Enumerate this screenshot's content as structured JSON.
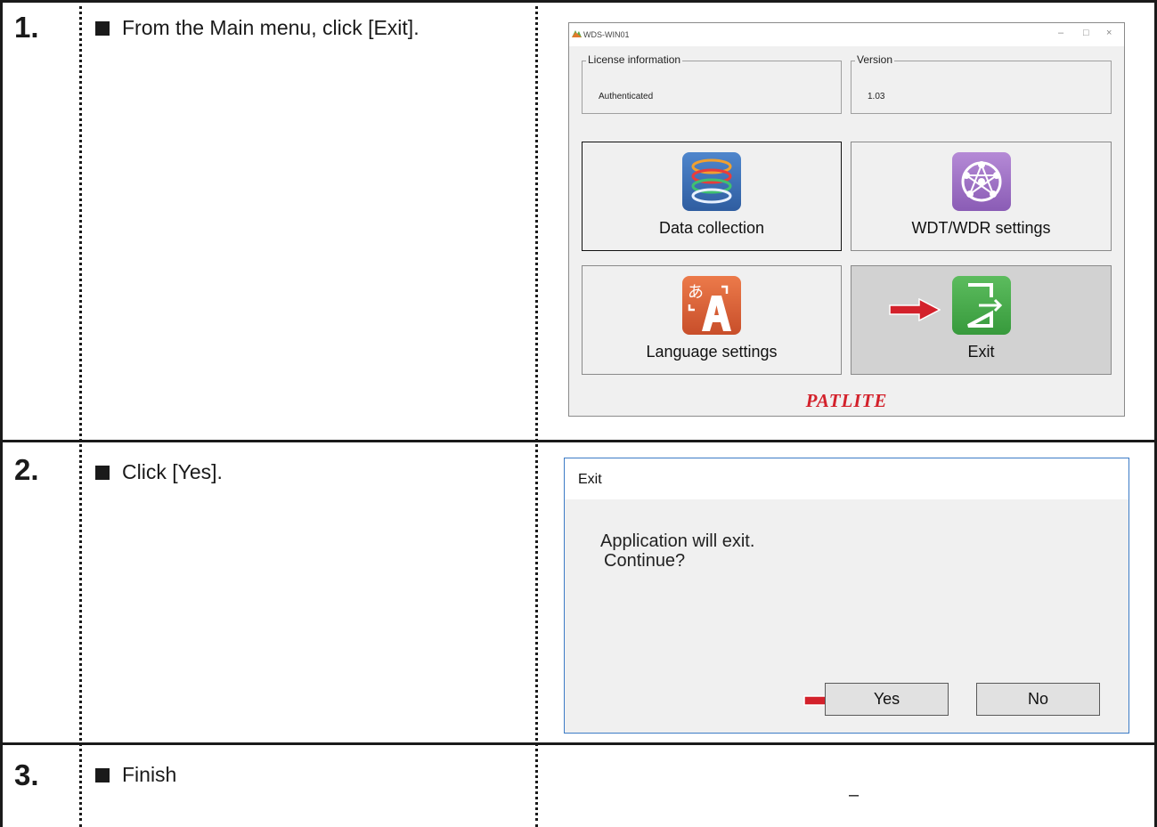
{
  "steps": [
    {
      "number": "1.",
      "instruction": "From the Main menu, click [Exit]."
    },
    {
      "number": "2.",
      "instruction": "Click [Yes]."
    },
    {
      "number": "3.",
      "instruction": "Finish",
      "screen_placeholder": "–"
    }
  ],
  "app_window": {
    "title": "WDS-WIN01",
    "controls": {
      "minimize": "–",
      "maximize": "□",
      "close": "×"
    },
    "license_group": {
      "label": "License information",
      "value": "Authenticated"
    },
    "version_group": {
      "label": "Version",
      "value": "1.03"
    },
    "tiles": [
      {
        "label": "Data collection",
        "icon": "data-collection-icon",
        "color": "#3f6fb4"
      },
      {
        "label": "WDT/WDR settings",
        "icon": "network-icon",
        "color": "#9b6fc0"
      },
      {
        "label": "Language settings",
        "icon": "language-icon",
        "color": "#d8623a"
      },
      {
        "label": "Exit",
        "icon": "exit-door-icon",
        "color": "#46a84b"
      }
    ],
    "logo": "PATLITE"
  },
  "dialog": {
    "title": "Exit",
    "message_line1": "Application will exit.",
    "message_line2": "Continue?",
    "yes_label": "Yes",
    "no_label": "No"
  },
  "colors": {
    "arrow": "#d3212b",
    "logo": "#d3212b",
    "dialog_border": "#3c7bc6"
  }
}
